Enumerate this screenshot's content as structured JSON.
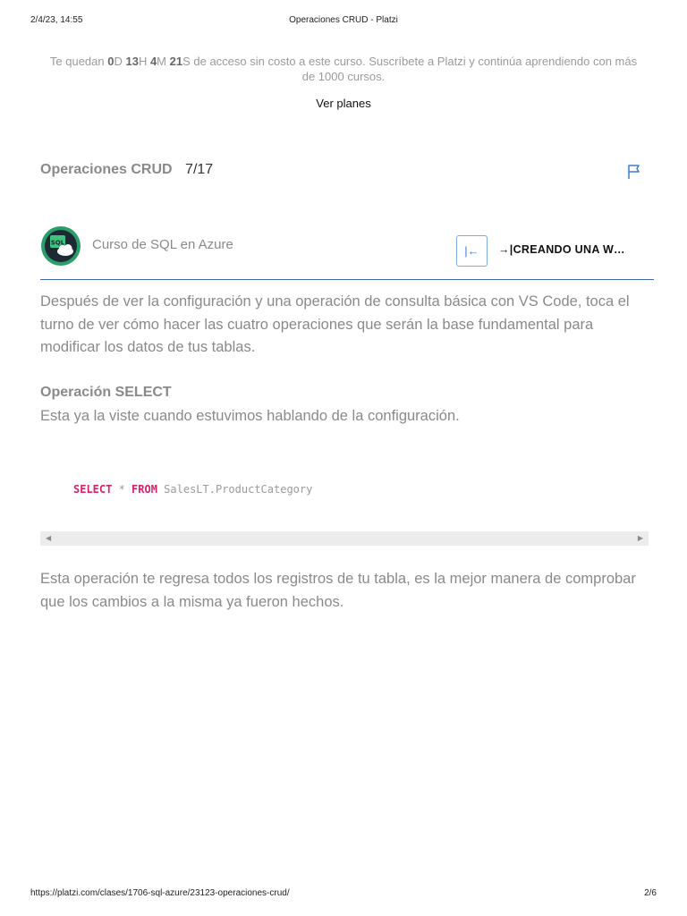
{
  "print_header": {
    "date": "2/4/23, 14:55",
    "title": "Operaciones CRUD - Platzi"
  },
  "banner": {
    "prefix": "Te quedan ",
    "days_num": "0",
    "days_unit": "D ",
    "hours_num": "13",
    "hours_unit": "H ",
    "minutes_num": "4",
    "minutes_unit": "M ",
    "seconds_num": "21",
    "seconds_unit": "S",
    "suffix": " de acceso sin costo a este curso. Suscríbete a Platzi y continúa aprendiendo con más de 1000 cursos.",
    "link": "Ver planes"
  },
  "class_header": {
    "title": "Operaciones CRUD",
    "progress": "7/17",
    "flag_icon": "flag-icon"
  },
  "course": {
    "logo_text": "SQL",
    "name": "Curso de SQL en Azure",
    "prev_icon": "|←",
    "next_label": "→|CREANDO UNA W…"
  },
  "content": {
    "p1": "Después de ver la configuración y una operación de consulta básica con VS Code, toca el turno de ver cómo hacer las cuatro operaciones que serán la base fundamental para modificar los datos de tus tablas.",
    "h_select": "Operación SELECT",
    "p2": "Esta ya la viste cuando estuvimos hablando de la configuración.",
    "code": {
      "kw1": "SELECT",
      "star": " * ",
      "kw2": "FROM",
      "rest": " SalesLT.ProductCategory"
    },
    "p3": "Esta operación te regresa todos los registros de tu tabla, es la mejor manera de comprobar que los cambios a la misma ya fueron hechos."
  },
  "print_footer": {
    "url": "https://platzi.com/clases/1706-sql-azure/23123-operaciones-crud/",
    "page": "2/6"
  },
  "colors": {
    "accent": "#3a7fd0",
    "divider": "#3f66a8",
    "keyword": "#d6216a",
    "logo_ring": "#2a9d6b"
  }
}
